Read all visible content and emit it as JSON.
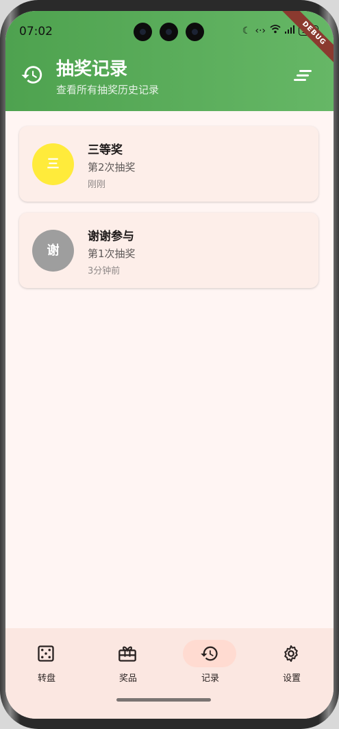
{
  "status_bar": {
    "time": "07:02",
    "battery": "100",
    "debug_banner": "DEBUG"
  },
  "header": {
    "title": "抽奖记录",
    "subtitle": "查看所有抽奖历史记录",
    "leading_icon": "history-icon",
    "action_icon": "sort-icon"
  },
  "records": [
    {
      "avatar_text": "三",
      "avatar_color": "#ffeb3b",
      "prize": "三等奖",
      "draw": "第2次抽奖",
      "time": "刚刚"
    },
    {
      "avatar_text": "谢",
      "avatar_color": "#9e9e9e",
      "prize": "谢谢参与",
      "draw": "第1次抽奖",
      "time": "3分钟前"
    }
  ],
  "nav": {
    "items": [
      {
        "label": "转盘",
        "icon": "dice-icon",
        "active": false
      },
      {
        "label": "奖品",
        "icon": "gift-icon",
        "active": false
      },
      {
        "label": "记录",
        "icon": "history-icon",
        "active": true
      },
      {
        "label": "设置",
        "icon": "gear-icon",
        "active": false
      }
    ]
  },
  "colors": {
    "app_bar": "#5cae5c",
    "background": "#fff5f3",
    "card": "#fdeee9",
    "nav_bar": "#fbe7e1",
    "nav_active_pill": "#ffdbd1"
  }
}
